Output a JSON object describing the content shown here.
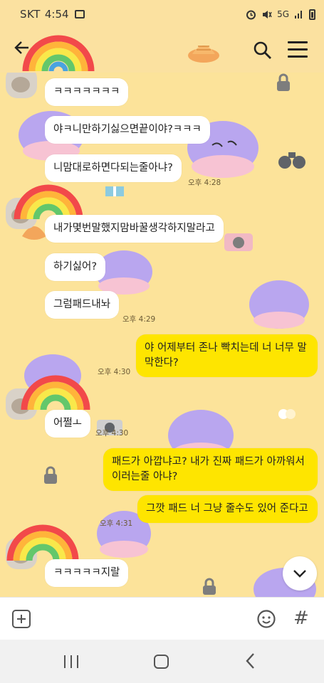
{
  "status_bar": {
    "carrier": "SKT",
    "time": "4:54",
    "network": "5G"
  },
  "header": {
    "back_icon": "back-arrow-icon",
    "search_icon": "search-icon",
    "menu_icon": "hamburger-menu-icon"
  },
  "messages": [
    {
      "text": "ㅋㅋㅋㅋㅋㅋㅋ"
    },
    {
      "text": "야ㅋ니만하기싫으면끝이야?ㅋㅋㅋ"
    },
    {
      "text": "니맘대로하면다되는줄아냐?",
      "time": "오후 4:28"
    },
    {
      "text": "내가몇번말했지맘바꿀생각하지말라고"
    },
    {
      "text": "하기싫어?"
    },
    {
      "text": "그럼패드내놔",
      "time": "오후 4:29"
    },
    {
      "text": "야 어제부터 존나 빡치는데 너 너무 말 막한다?",
      "time": "오후 4:30"
    },
    {
      "text": "어쩔ㅗ",
      "time": "오후 4:30"
    },
    {
      "text": "패드가 아깝냐고? 내가 진짜 패드가 아까워서 이러는줄 아냐?"
    },
    {
      "text": "그깟 패드 너 그냥 줄수도 있어 준다고",
      "time": "오후 4:31"
    },
    {
      "text": "ㅋㅋㅋㅋㅋ지랄"
    }
  ],
  "colors": {
    "background": "#fce39a",
    "my_bubble": "#fee500",
    "their_bubble": "#ffffff"
  },
  "input_bar": {
    "plus_icon": "plus-icon",
    "emoji_icon": "emoji-icon",
    "hash_icon": "#"
  },
  "nav_bar": {
    "recent_icon": "recent-apps-icon",
    "home_icon": "home-icon",
    "back_icon": "nav-back-icon"
  }
}
